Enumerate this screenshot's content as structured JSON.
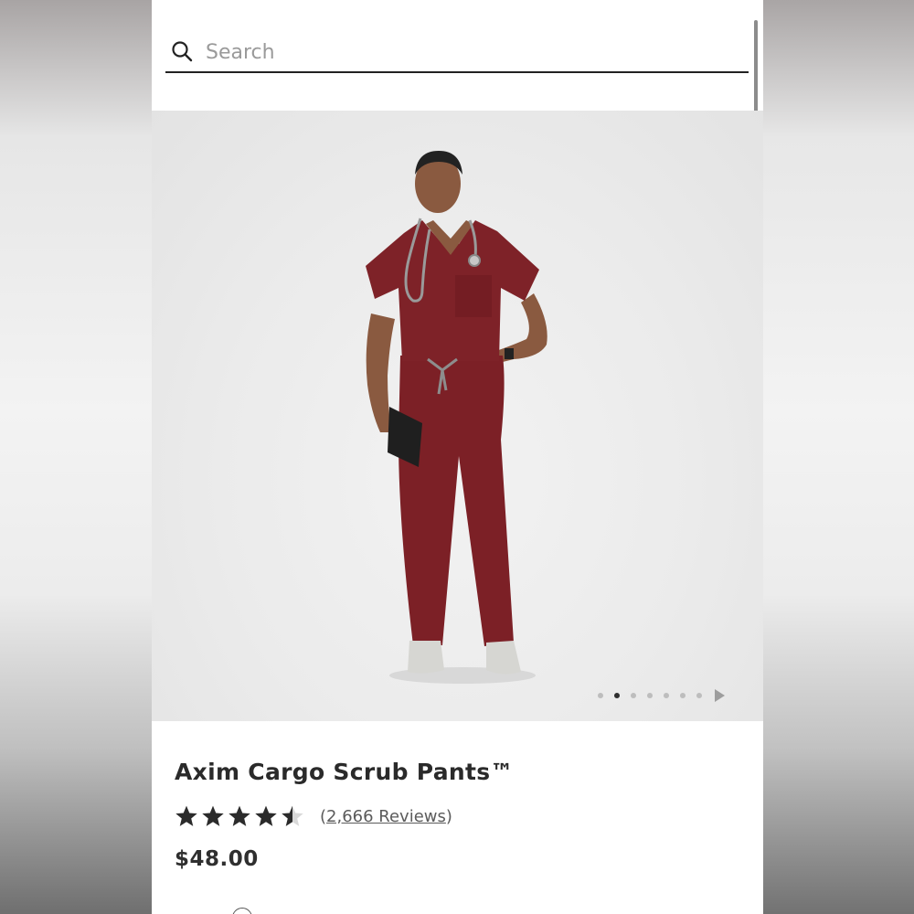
{
  "search": {
    "placeholder": "Search",
    "value": ""
  },
  "product": {
    "title": "Axim Cargo Scrub Pants™",
    "rating": 4.5,
    "rating_max": 5,
    "reviews_open": "(",
    "reviews_label": "2,666 Reviews",
    "reviews_close": ")",
    "price": "$48.00",
    "colors": {
      "scrub": "#7a1f24",
      "background": "#ececec",
      "text": "#2a2a2a"
    }
  },
  "carousel": {
    "dot_count": 7,
    "active_index": 1,
    "next_icon": "play-arrow-icon"
  },
  "icons": {
    "search": "search-icon",
    "star": "star-icon"
  }
}
